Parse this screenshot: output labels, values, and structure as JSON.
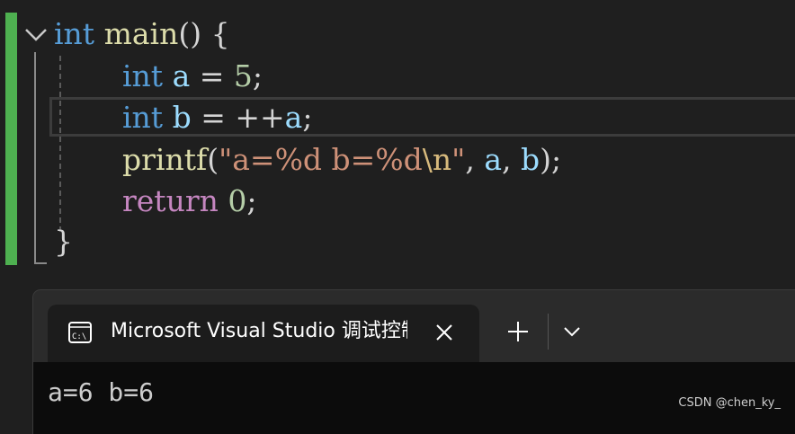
{
  "editor": {
    "line1": {
      "kw": "int",
      "fn": "main",
      "rest": "() {"
    },
    "line2": {
      "kw": "int",
      "var": "a",
      "op": " = ",
      "num": "5",
      "end": ";"
    },
    "line3": {
      "kw": "int",
      "var": "b",
      "op": " = ++",
      "var2": "a",
      "end": ";"
    },
    "line4": {
      "fn": "printf",
      "open": "(",
      "str1": "\"a=%d b=%d",
      "esc": "\\n",
      "str2": "\"",
      "comma1": ", ",
      "arg1": "a",
      "comma2": ", ",
      "arg2": "b",
      "close": ");"
    },
    "line5": {
      "ctrl": "return",
      "num": "0",
      "end": ";"
    },
    "line6": {
      "text": "}"
    }
  },
  "terminal": {
    "tab_title": "Microsoft Visual Studio 调试控制台",
    "output": "a=6 b=6"
  },
  "watermark": "CSDN @chen_ky_",
  "colors": {
    "keyword": "#569cd6",
    "function": "#dcdcaa",
    "variable": "#9cdcfe",
    "number": "#b5cea8",
    "string": "#ce9178",
    "control": "#c586c0",
    "change_bar": "#4eb050"
  }
}
